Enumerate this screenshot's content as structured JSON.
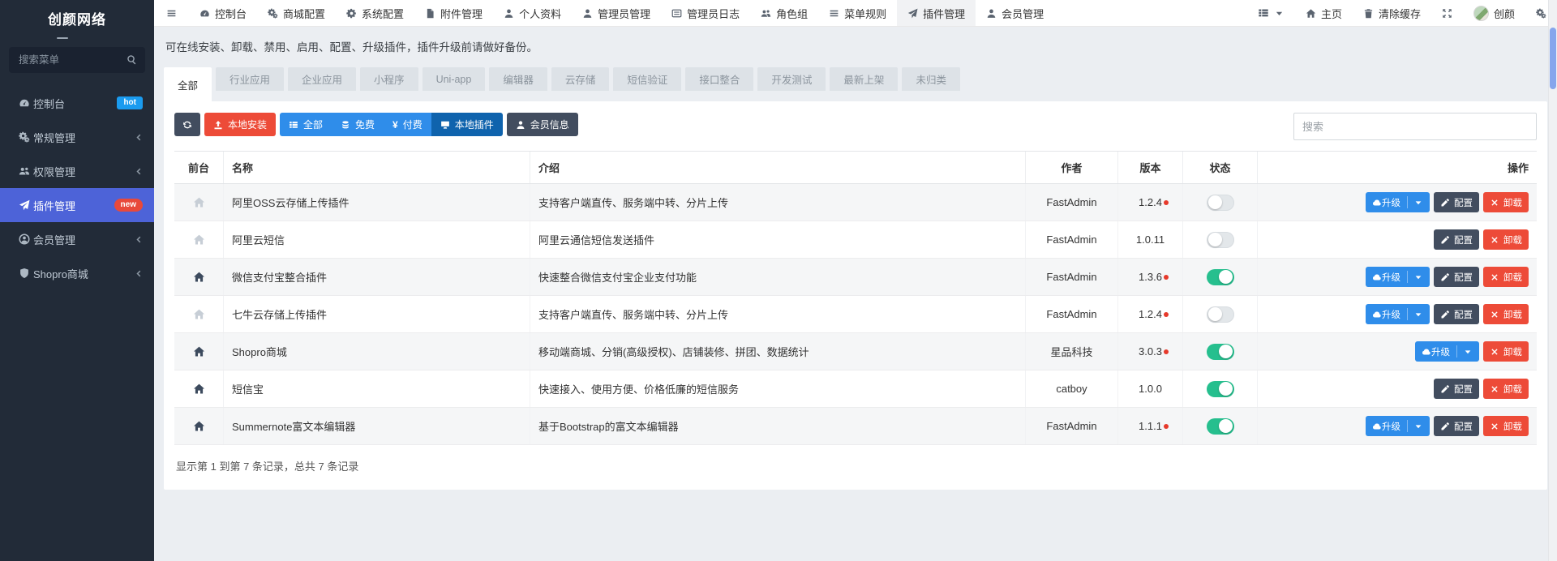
{
  "colors": {
    "sidebar_bg": "#222b38",
    "active_menu": "#4d63d8",
    "badge_hot": "#1a9bef",
    "badge_new": "#e8493b",
    "btn_blue": "#2f8dea",
    "btn_blue_active": "#0f63ad",
    "btn_red": "#ed4b38",
    "btn_dark": "#424d5f",
    "toggle_on": "#26bf8e",
    "update_dot": "#e6392b"
  },
  "sidebar": {
    "brand": "创颜网络",
    "search_placeholder": "搜索菜单",
    "items": [
      {
        "label": "控制台",
        "badge": "hot"
      },
      {
        "label": "常规管理"
      },
      {
        "label": "权限管理"
      },
      {
        "label": "插件管理",
        "badge": "new"
      },
      {
        "label": "会员管理"
      },
      {
        "label": "Shopro商城"
      }
    ]
  },
  "topnav": {
    "items": [
      "控制台",
      "商城配置",
      "系统配置",
      "附件管理",
      "个人资料",
      "管理员管理",
      "管理员日志",
      "角色组",
      "菜单规则",
      "插件管理",
      "会员管理"
    ],
    "home": "主页",
    "clear_cache": "清除缓存",
    "username": "创颜"
  },
  "content": {
    "notice": "可在线安装、卸载、禁用、启用、配置、升级插件，插件升级前请做好备份。",
    "tabs": [
      "全部",
      "行业应用",
      "企业应用",
      "小程序",
      "Uni-app",
      "编辑器",
      "云存储",
      "短信验证",
      "接口整合",
      "开发测试",
      "最新上架",
      "未归类"
    ],
    "toolbar": {
      "install": "本地安装",
      "all": "全部",
      "free": "免费",
      "paid": "付费",
      "paid_symbol": "¥",
      "local": "本地插件",
      "member": "会员信息",
      "search_placeholder": "搜索"
    },
    "table": {
      "headers": {
        "front": "前台",
        "name": "名称",
        "intro": "介绍",
        "author": "作者",
        "version": "版本",
        "status": "状态",
        "action": "操作"
      },
      "buttons": {
        "upgrade": "升级",
        "config": "配置",
        "uninstall": "卸载"
      },
      "rows": [
        {
          "name": "阿里OSS云存储上传插件",
          "intro": "支持客户端直传、服务端中转、分片上传",
          "author": "FastAdmin",
          "version": "1.2.4"
        },
        {
          "name": "阿里云短信",
          "intro": "阿里云通信短信发送插件",
          "author": "FastAdmin",
          "version": "1.0.11"
        },
        {
          "name": "微信支付宝整合插件",
          "intro": "快速整合微信支付宝企业支付功能",
          "author": "FastAdmin",
          "version": "1.3.6"
        },
        {
          "name": "七牛云存储上传插件",
          "intro": "支持客户端直传、服务端中转、分片上传",
          "author": "FastAdmin",
          "version": "1.2.4"
        },
        {
          "name": "Shopro商城",
          "intro": "移动端商城、分销(高级授权)、店铺装修、拼团、数据统计",
          "author": "星品科技",
          "version": "3.0.3"
        },
        {
          "name": "短信宝",
          "intro": "快速接入、使用方便、价格低廉的短信服务",
          "author": "catboy",
          "version": "1.0.0"
        },
        {
          "name": "Summernote富文本编辑器",
          "intro": "基于Bootstrap的富文本编辑器",
          "author": "FastAdmin",
          "version": "1.1.1"
        }
      ],
      "footer": "显示第 1 到第 7 条记录，总共 7 条记录"
    }
  }
}
